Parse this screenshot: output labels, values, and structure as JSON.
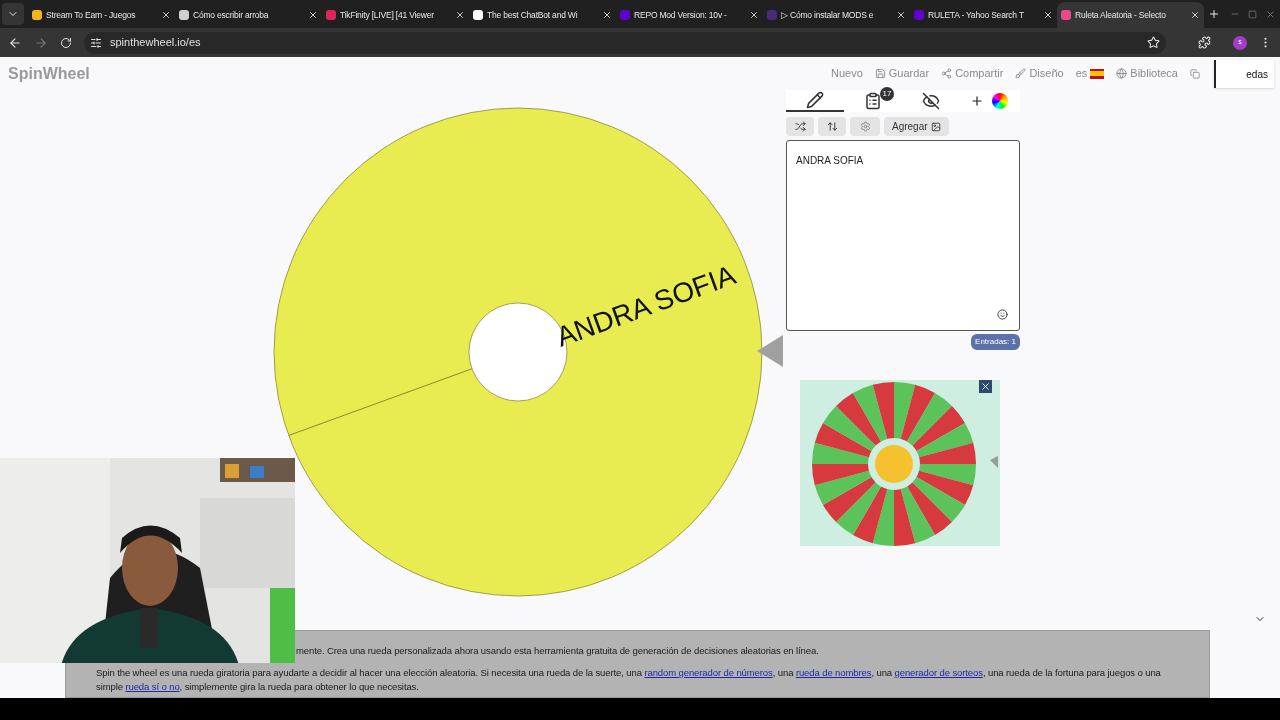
{
  "browser": {
    "tabs": [
      {
        "title": "Stream To Earn - Juegos",
        "selected": false,
        "color": "#f2b51c"
      },
      {
        "title": "Cómo escribir arroba",
        "selected": false,
        "color": "#cfcfcf"
      },
      {
        "title": "TikFinity [LIVE] [41 Viewer",
        "selected": false,
        "color": "#e0245e"
      },
      {
        "title": "The best ChatBot and Wi",
        "selected": false,
        "color": "#ffffff"
      },
      {
        "title": "REPO Mod Version: 10v -",
        "selected": false,
        "color": "#6001d2"
      },
      {
        "title": "▷ Cómo instalar MODS e",
        "selected": false,
        "color": "#4b2a7a"
      },
      {
        "title": "RULETA - Yahoo Search T",
        "selected": false,
        "color": "#6001d2"
      },
      {
        "title": "Ruleta Aleatoria - Selecto",
        "selected": true,
        "color": "#e94b8a"
      }
    ],
    "url": "spinthewheel.io/es",
    "profile": "s"
  },
  "site": {
    "logo": "SpinWheel",
    "menu": [
      "Nuevo",
      "Guardar",
      "Compartir",
      "Diseño",
      "es",
      "Biblioteca"
    ],
    "popup_text": "edas"
  },
  "wheel": {
    "entries": [
      {
        "label": "ANDRA SOFIA",
        "color": "#e8ec50"
      }
    ]
  },
  "editor": {
    "tabs": [
      {
        "kind": "edit",
        "selected": true
      },
      {
        "kind": "results",
        "selected": false,
        "badge": "17"
      },
      {
        "kind": "hidden",
        "selected": false
      },
      {
        "kind": "add",
        "selected": false
      }
    ],
    "add_button": "Agregar",
    "text": "ANDRA SOFIA",
    "count": "Entradas: 1"
  },
  "info": {
    "lines": [
      [
        {
          "text": "mente. Crea una rueda personalizada ahora usando esta herramienta gratuita de generación de decisiones aleatorias en línea."
        }
      ],
      [
        {
          "text": "Spin the wheel es una rueda giratoria para ayudarte a decidir al hacer una elección aleatoria. Si necesita una rueda de la suerte, una "
        },
        {
          "text": "random generador de números",
          "link": true
        },
        {
          "text": ", una "
        },
        {
          "text": "rueda de nombres",
          "link": true
        },
        {
          "text": ", una "
        },
        {
          "text": "generador de sorteos",
          "link": true
        },
        {
          "text": ", una rueda de la fortuna para juegos o una"
        }
      ],
      [
        {
          "text": "simple "
        },
        {
          "text": "rueda sí o no",
          "link": true
        },
        {
          "text": ", simplemente gira la rueda para obtener lo que necesitas."
        }
      ]
    ]
  }
}
